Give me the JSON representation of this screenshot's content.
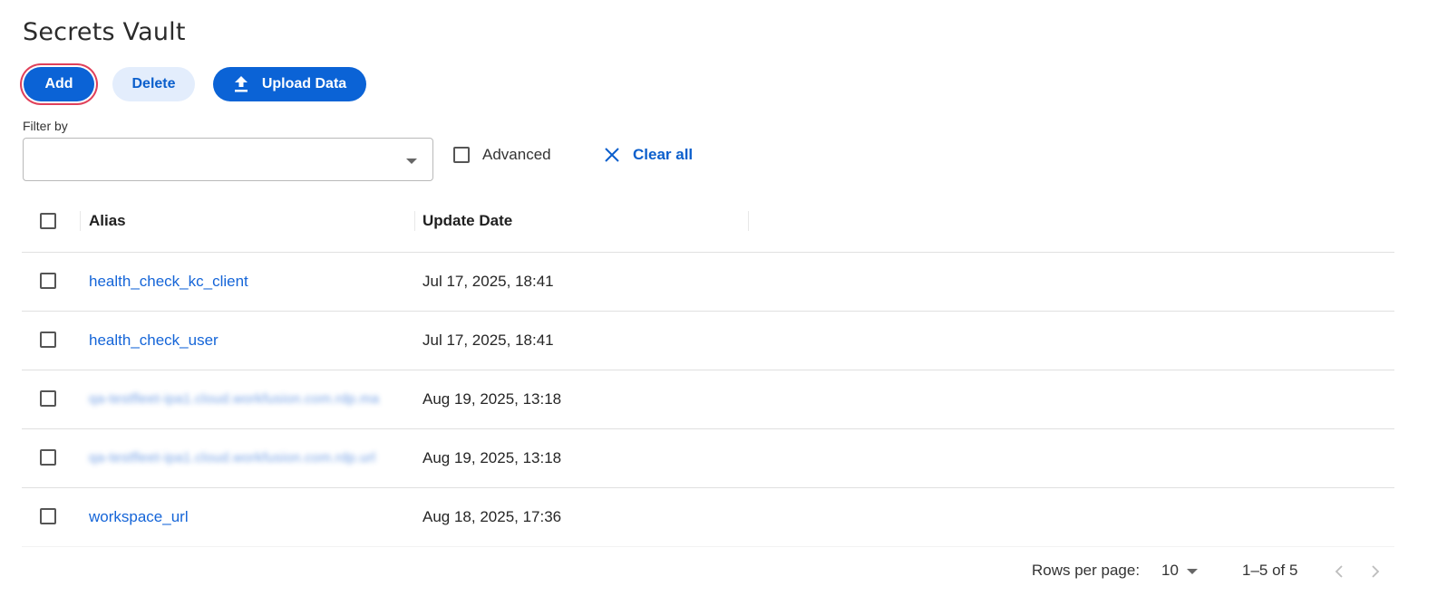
{
  "page": {
    "title": "Secrets Vault"
  },
  "toolbar": {
    "add_label": "Add",
    "delete_label": "Delete",
    "upload_label": "Upload Data",
    "upload_icon": "upload-icon"
  },
  "filter": {
    "label": "Filter by",
    "value": "",
    "advanced_label": "Advanced",
    "advanced_checked": false,
    "clear_all_label": "Clear all",
    "clear_icon": "close-icon"
  },
  "table": {
    "columns": [
      "Alias",
      "Update Date"
    ],
    "rows": [
      {
        "alias": "health_check_kc_client",
        "update_date": "Jul 17, 2025, 18:41",
        "blurred": false
      },
      {
        "alias": "qa-testfleet-ipa1.cloud.workfusion.com.rdp.ma",
        "update_date": "Aug 19, 2025, 13:18",
        "blurred": true
      },
      {
        "alias": "health_check_user",
        "update_date": "Jul 17, 2025, 18:41",
        "blurred": false
      },
      {
        "alias": "qa-testfleet-ipa1.cloud.workfusion.com.rdp.url",
        "update_date": "Aug 19, 2025, 13:18",
        "blurred": true
      },
      {
        "alias": "workspace_url",
        "update_date": "Aug 18, 2025, 17:36",
        "blurred": false
      }
    ]
  },
  "pagination": {
    "rows_per_page_label": "Rows per page:",
    "rows_per_page_value": "10",
    "range_label": "1–5 of 5",
    "prev_icon": "chevron-left-icon",
    "next_icon": "chevron-right-icon"
  },
  "colors": {
    "primary": "#0b63d6",
    "link": "#1565d8",
    "secondary_bg": "#e3edfc",
    "focus_ring": "#e0405a"
  }
}
